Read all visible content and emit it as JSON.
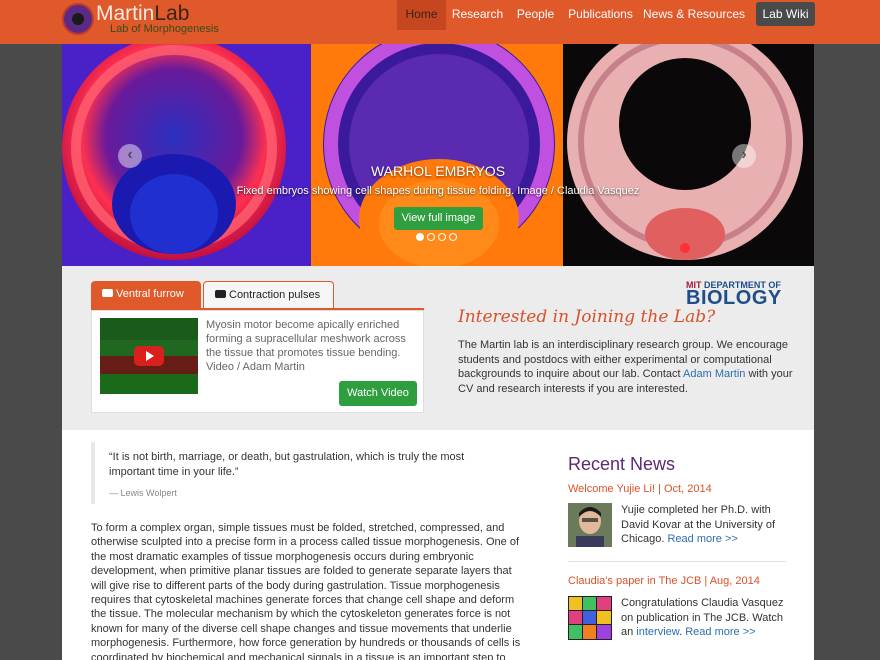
{
  "site": {
    "name_part1": "Martin",
    "name_part2": "Lab",
    "subtitle": "Lab of Morphogenesis"
  },
  "nav": {
    "items": [
      {
        "label": "Home",
        "active": true
      },
      {
        "label": "Research"
      },
      {
        "label": "People"
      },
      {
        "label": "Publications"
      },
      {
        "label": "News & Resources"
      }
    ],
    "wiki_label": "Lab Wiki"
  },
  "carousel": {
    "title": "WARHOL EMBRYOS",
    "caption": "Fixed embryos showing cell shapes during tissue folding. Image / Claudia Vasquez",
    "button_label": "View full image",
    "prev_icon": "chevron-left-icon",
    "next_icon": "chevron-right-icon",
    "slide_count": 4,
    "active_slide": 1
  },
  "feature": {
    "tabs": [
      {
        "label": "Ventral furrow",
        "icon": "video-icon",
        "active": true
      },
      {
        "label": "Contraction pulses",
        "icon": "video-icon",
        "active": false
      }
    ],
    "video_description": "Myosin motor become apically enriched forming a supracellular meshwork across the tissue that promotes tissue bending. Video / Adam Martin",
    "watch_label": "Watch Video",
    "biology_top_mit": "MIT",
    "biology_top_rest": "DEPARTMENT OF",
    "biology_big": "BIOLOGY",
    "join_title": "Interested in Joining the Lab?",
    "join_text_before": "The Martin lab is an interdisciplinary research group. We encourage students and postdocs with either experimental or computational backgrounds to inquire about our lab. Contact ",
    "join_link": "Adam Martin",
    "join_text_after": " with your CV and research interests if you are interested."
  },
  "quote": {
    "text": "“It is not birth, marriage, or death, but gastrulation, which is truly the most important time in your life.”",
    "author": "— Lewis Wolpert"
  },
  "body_text": "To form a complex organ, simple tissues must be folded, stretched, compressed, and otherwise sculpted into a precise form in a process called tissue morphogenesis. One of the most dramatic examples of tissue morphogenesis occurs during embryonic development, when primitive planar tissues are folded to generate separate layers that will give rise to different parts of the body during gastrulation. Tissue morphogenesis requires that cytoskeletal machines generate forces that change cell shape and deform the tissue. The molecular mechanism by which the cytoskeleton generates force is not known for many of the diverse cell shape changes and tissue movements that underlie morphogenesis. Furthermore, how force generation by hundreds or thousands of cells is coordinated by biochemical and mechanical signals in a tissue is an important step to understand how cells",
  "news": {
    "heading": "Recent News",
    "items": [
      {
        "title": "Welcome Yujie Li! | Oct, 2014",
        "text": "Yujie completed her Ph.D. with David Kovar at the University of Chicago. ",
        "link": "Read more >>"
      },
      {
        "title": "Claudia's paper in The JCB | Aug, 2014",
        "text_before": "Congratulations Claudia Vasquez on publication in The JCB. Watch an ",
        "inline_link": "interview",
        "text_after": ". ",
        "link": "Read more >>"
      }
    ]
  },
  "colors": {
    "brand_orange": "#e0592a",
    "button_green": "#2e9e3e",
    "news_purple": "#5a2a75",
    "link_blue": "#2a6fb0"
  }
}
